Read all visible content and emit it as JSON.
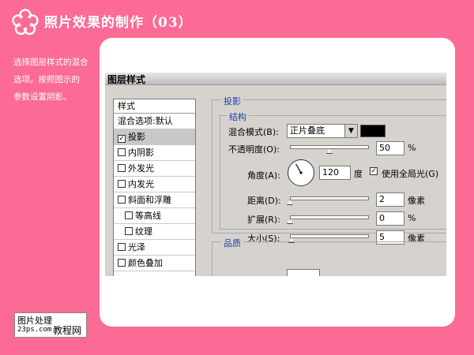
{
  "header": {
    "title": "照片效果的制作（03）"
  },
  "description": {
    "lines": [
      "选择图层样式的混合",
      "选项。按照图示的",
      "参数设置阴影。"
    ]
  },
  "badge": {
    "main": "图片处理",
    "domain": "23ps.com",
    "sub": "教程网"
  },
  "dialog": {
    "title": "图层样式",
    "style_list": {
      "header": "样式",
      "items": [
        {
          "label": "混合选项:默认",
          "checkbox": false,
          "checked": false,
          "sub": false,
          "active": false
        },
        {
          "label": "投影",
          "checkbox": true,
          "checked": true,
          "sub": false,
          "active": true
        },
        {
          "label": "内阴影",
          "checkbox": true,
          "checked": false,
          "sub": false,
          "active": false
        },
        {
          "label": "外发光",
          "checkbox": true,
          "checked": false,
          "sub": false,
          "active": false
        },
        {
          "label": "内发光",
          "checkbox": true,
          "checked": false,
          "sub": false,
          "active": false
        },
        {
          "label": "斜面和浮雕",
          "checkbox": true,
          "checked": false,
          "sub": false,
          "active": false
        },
        {
          "label": "等高线",
          "checkbox": true,
          "checked": false,
          "sub": true,
          "active": false
        },
        {
          "label": "纹理",
          "checkbox": true,
          "checked": false,
          "sub": true,
          "active": false
        },
        {
          "label": "光泽",
          "checkbox": true,
          "checked": false,
          "sub": false,
          "active": false
        },
        {
          "label": "颜色叠加",
          "checkbox": true,
          "checked": false,
          "sub": false,
          "active": false
        }
      ]
    },
    "shadow": {
      "group_label": "投影",
      "structure_label": "结构",
      "blend_mode_label": "混合模式(B):",
      "blend_mode_value": "正片叠底",
      "blend_color": "#000000",
      "opacity_label": "不透明度(O):",
      "opacity_value": "50",
      "opacity_unit": "%",
      "opacity_fraction": 0.5,
      "angle_label": "角度(A):",
      "angle_value": "120",
      "angle_unit": "度",
      "angle_degrees": 120,
      "global_light_label": "使用全局光(G)",
      "global_light_checked": true,
      "distance_label": "距离(D):",
      "distance_value": "2",
      "distance_unit": "像素",
      "distance_fraction": 0.0,
      "spread_label": "扩展(R):",
      "spread_value": "0",
      "spread_unit": "%",
      "spread_fraction": 0.0,
      "size_label": "大小(S):",
      "size_value": "5",
      "size_unit": "像素",
      "size_fraction": 0.02,
      "quality_label": "品质"
    }
  }
}
